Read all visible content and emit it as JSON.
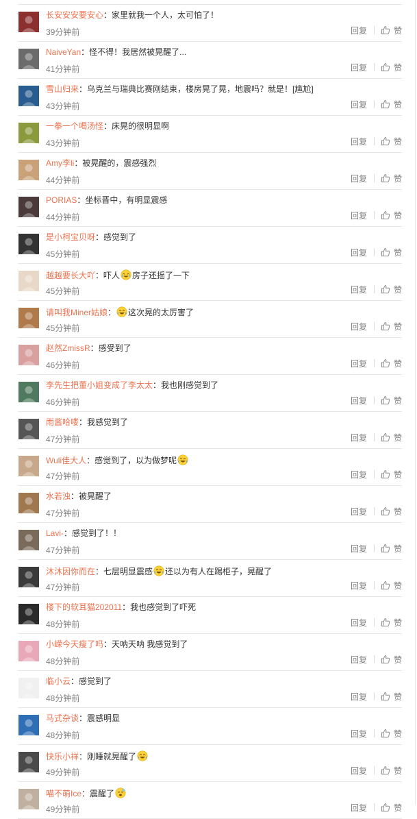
{
  "comments": {
    "reply_label": "回复",
    "like_label": "赞",
    "separator": "：",
    "items": [
      {
        "user": "长安安安要安心",
        "text": "家里就我一个人，太可怕了！",
        "time": "39分钟前",
        "avatar_color": "#8b2f2f"
      },
      {
        "user": "NaiveYan",
        "text": "怪不得！我居然被晃醒了...",
        "time": "41分钟前",
        "avatar_color": "#6b6b6b"
      },
      {
        "user": "雪山归来",
        "text": "乌克兰与瑞典比赛刚结束，楼房晃了晃，地震吗？就是！[尴尬]",
        "time": "43分钟前",
        "avatar_color": "#2a5d8f"
      },
      {
        "user": "一拳一个喝汤怪",
        "text": "床晃的很明显啊",
        "time": "43分钟前",
        "avatar_color": "#8a9a3c"
      },
      {
        "user": "Amy李li",
        "text": "被晃醒的，震感强烈",
        "time": "44分钟前",
        "avatar_color": "#c9a27a"
      },
      {
        "user": "PORIAS",
        "text": "坐标晋中，有明显震感",
        "time": "44分钟前",
        "avatar_color": "#4a3a3a"
      },
      {
        "user": "是小柯宝贝呀",
        "text": "感觉到了",
        "time": "45分钟前",
        "avatar_color": "#333333"
      },
      {
        "user": "越越要长大吖",
        "text": "吓人",
        "text2": "房子还摇了一下",
        "emoji": "cry-laugh-emoji",
        "time": "45分钟前",
        "avatar_color": "#e8d8c8"
      },
      {
        "user": "请叫我Miner姑娘",
        "text": "",
        "text2": "这次晃的太厉害了",
        "emoji": "laugh-cry-emoji",
        "time": "45分钟前",
        "avatar_color": "#b07a4a"
      },
      {
        "user": "赵然ZmissR",
        "text": "感受到了",
        "time": "46分钟前",
        "avatar_color": "#d9a0a0"
      },
      {
        "user": "李先生把董小姐变成了李太太",
        "text": "我也刚感觉到了",
        "time": "46分钟前",
        "avatar_color": "#4f7a5f"
      },
      {
        "user": "雨酱哈喽",
        "text": "我感觉到了",
        "time": "47分钟前",
        "avatar_color": "#555555"
      },
      {
        "user": "Wuli佳大人",
        "text": "感觉到了，以为做梦呢",
        "emoji_after": "laugh-cry-emoji",
        "time": "47分钟前",
        "avatar_color": "#c8a88a"
      },
      {
        "user": "水若浊",
        "text": "被晃醒了",
        "time": "47分钟前",
        "avatar_color": "#a07850"
      },
      {
        "user": "Lavi-",
        "text": "感觉到了！！",
        "time": "47分钟前",
        "avatar_color": "#7a6a5a"
      },
      {
        "user": "沐沐因你而在",
        "text": "七层明显震感",
        "text2": "还以为有人在踢柜子，晃醒了",
        "emoji": "laugh-cry-emoji",
        "time": "47分钟前",
        "avatar_color": "#3a3a3a"
      },
      {
        "user": "楼下的软耳猫202011",
        "text": "我也感觉到了吓死",
        "time": "48分钟前",
        "avatar_color": "#2a2a2a"
      },
      {
        "user": "小嵘今天瘦了吗",
        "text": "天呐天呐 我感觉到了",
        "time": "48分钟前",
        "avatar_color": "#e8a8b8"
      },
      {
        "user": "临小云",
        "text": "感觉到了",
        "time": "48分钟前",
        "avatar_color": "#f0f0f0"
      },
      {
        "user": "马式杂谈",
        "text": "震感明显",
        "time": "48分钟前",
        "avatar_color": "#2f6fb5"
      },
      {
        "user": "快乐小祥",
        "text": "刚睡就晃醒了",
        "emoji_after": "laugh-cry-emoji",
        "time": "49分钟前",
        "avatar_color": "#4a4a4a"
      },
      {
        "user": "喵不萌Ice",
        "text": "震醒了",
        "emoji_after": "sleepy-emoji",
        "time": "49分钟前",
        "avatar_color": "#c0b0a0"
      }
    ]
  }
}
